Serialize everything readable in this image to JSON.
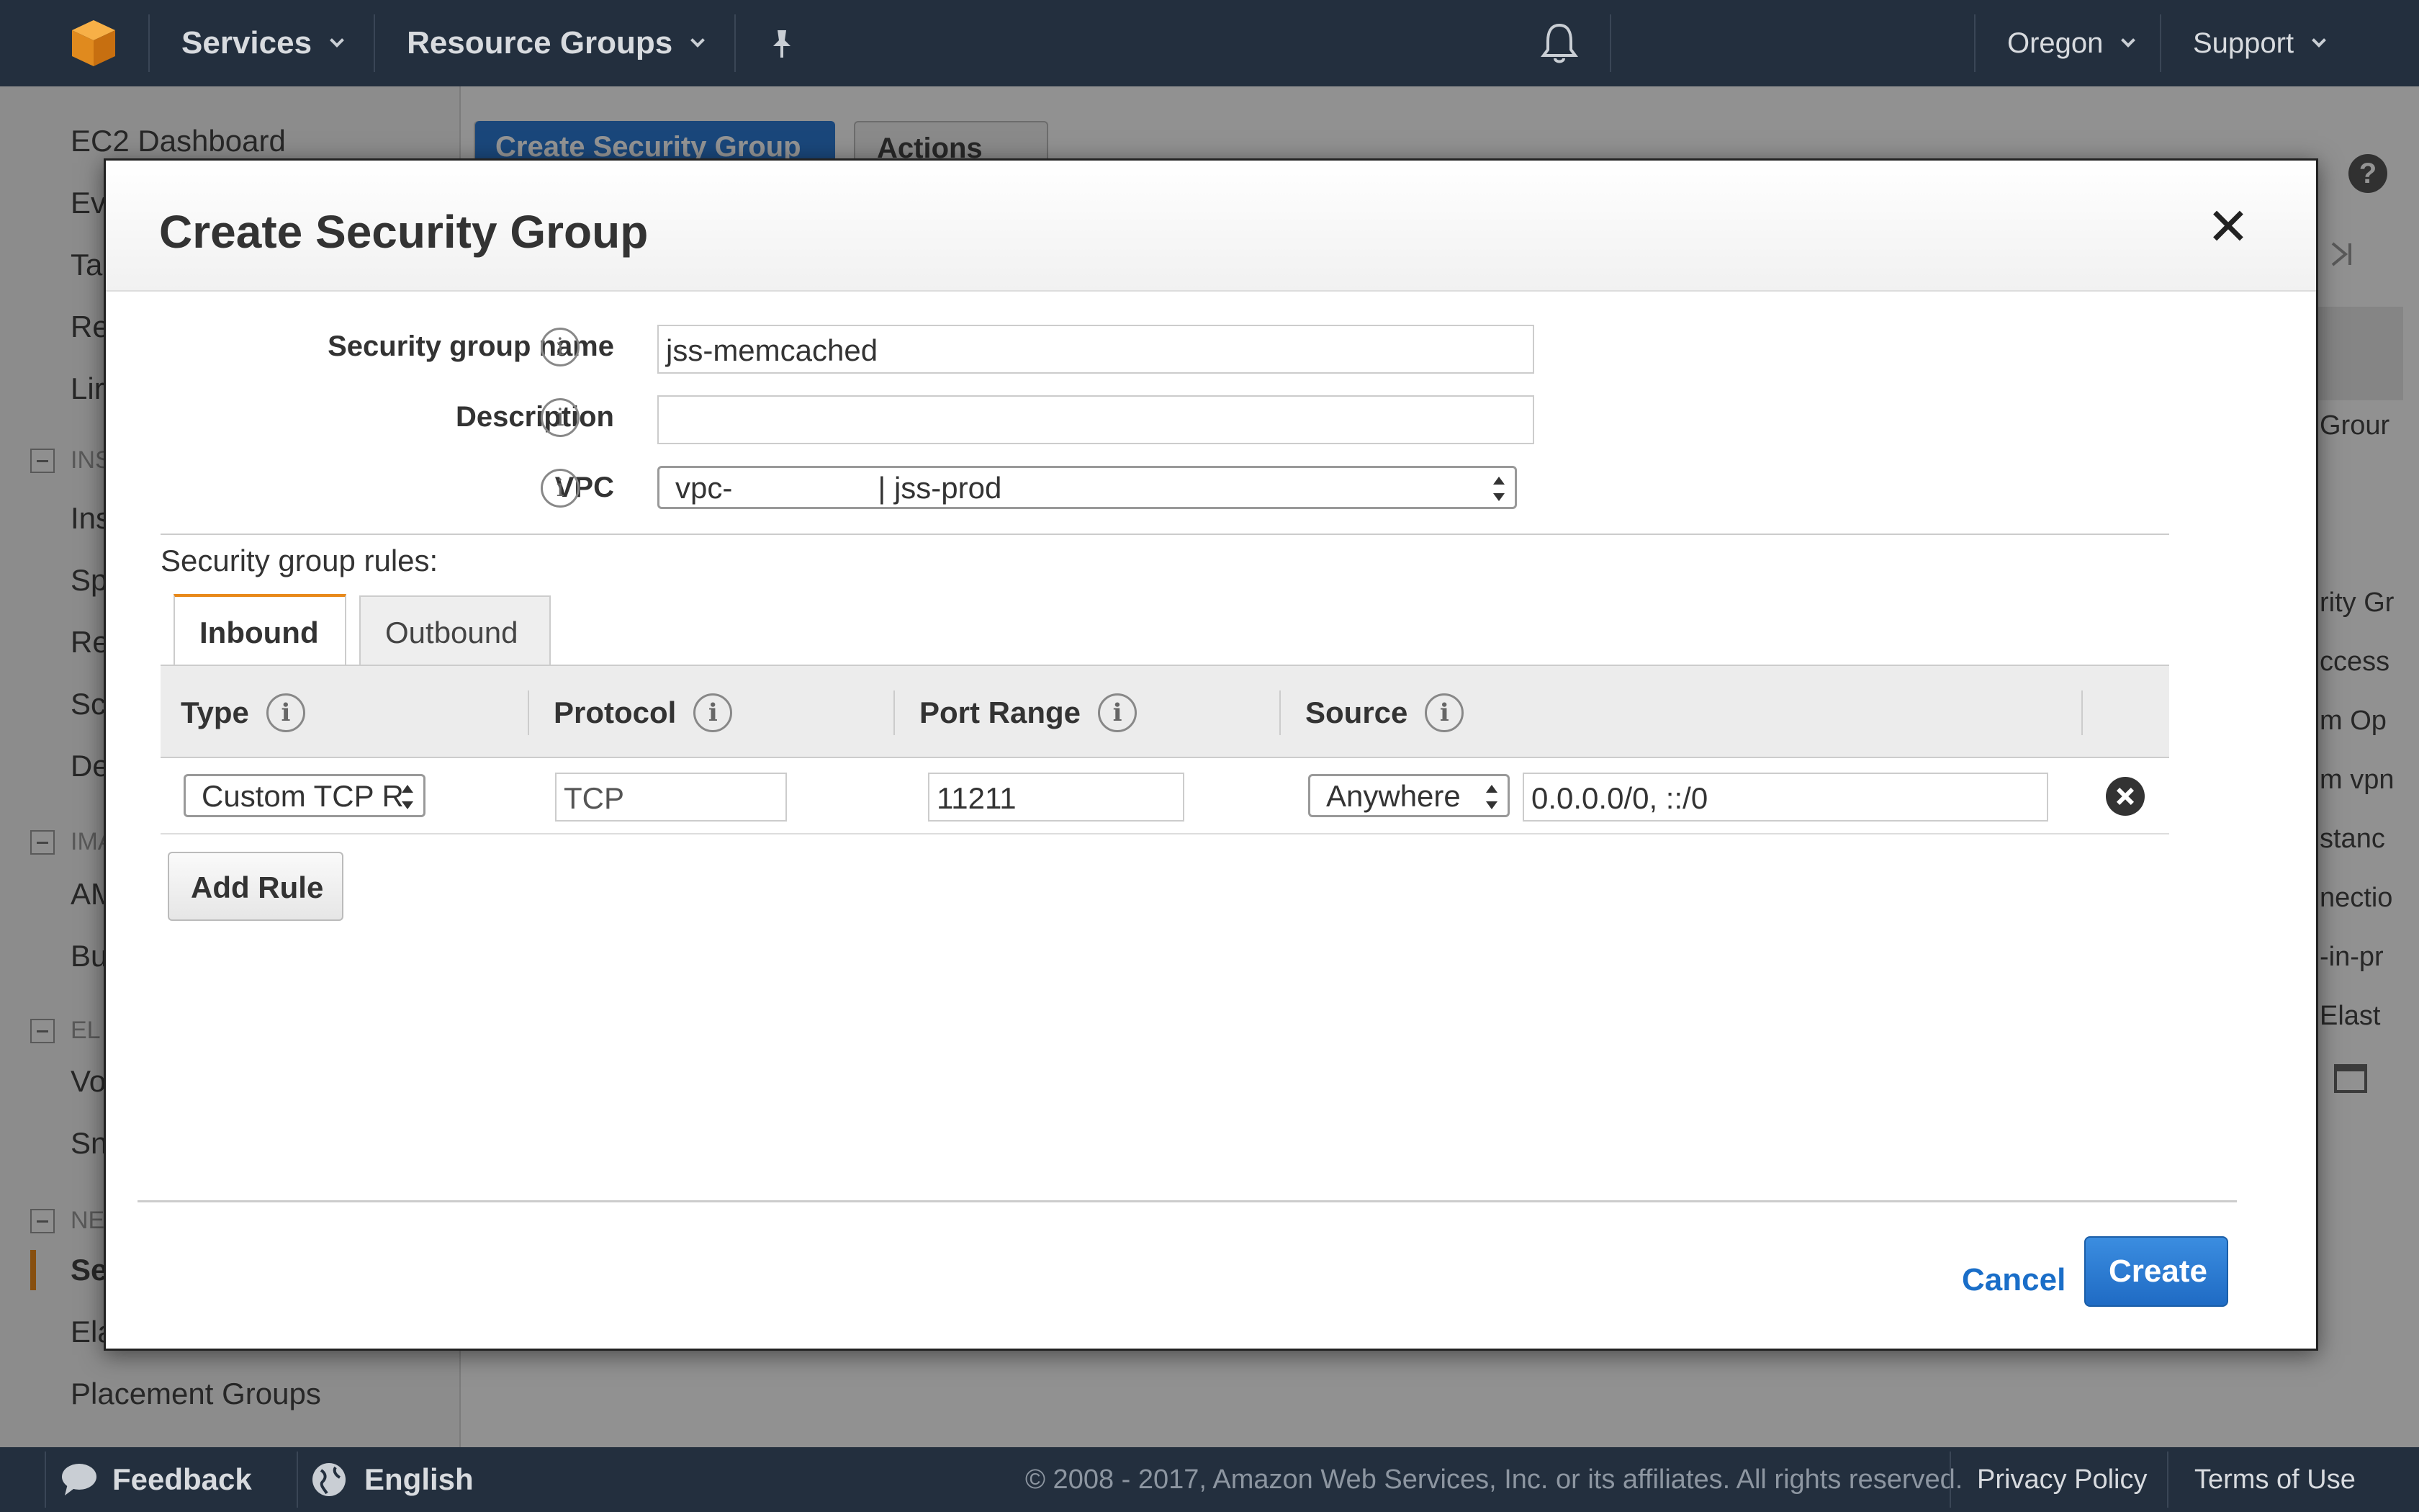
{
  "topnav": {
    "services": "Services",
    "resource_groups": "Resource Groups",
    "region": "Oregon",
    "support": "Support"
  },
  "sidebar": {
    "items": [
      "EC2 Dashboard",
      "Ev",
      "Ta",
      "Re",
      "Lir",
      "Ins",
      "Sp",
      "Re",
      "Sc",
      "De",
      "AM",
      "Bu",
      "Vo",
      "Sn",
      "Se",
      "Ela",
      "Placement Groups"
    ],
    "sections": [
      "INS",
      "IMA",
      "EL",
      "NE"
    ]
  },
  "background": {
    "create_button": "Create Security Group",
    "actions_button": "Actions",
    "right_fragments": [
      "Grour",
      "rity Gr",
      "ccess",
      "m Op",
      "m vpn",
      "stanc",
      "nectio",
      "-in-pr",
      "Elast"
    ]
  },
  "modal": {
    "title": "Create Security Group",
    "name_label": "Security group name",
    "name_value": "jss-memcached",
    "description_label": "Description",
    "description_value": "",
    "vpc_label": "VPC",
    "vpc_prefix": "vpc-",
    "vpc_name": "| jss-prod",
    "rules_label": "Security group rules:",
    "tabs": [
      "Inbound",
      "Outbound"
    ],
    "columns": [
      "Type",
      "Protocol",
      "Port Range",
      "Source"
    ],
    "rule": {
      "type": "Custom TCP R",
      "protocol": "TCP",
      "port_range": "11211",
      "source_mode": "Anywhere",
      "source_value": "0.0.0.0/0, ::/0"
    },
    "add_rule": "Add Rule",
    "cancel": "Cancel",
    "create": "Create"
  },
  "footer": {
    "feedback": "Feedback",
    "language": "English",
    "copyright": "© 2008 - 2017, Amazon Web Services, Inc. or its affiliates. All rights reserved.",
    "privacy": "Privacy Policy",
    "terms": "Terms of Use"
  },
  "colors": {
    "nav_bg": "#232f3e",
    "accent_orange": "#e8891a",
    "primary_blue": "#1f6bc4",
    "link_blue": "#1a6ec8"
  },
  "icons": [
    "aws-logo-icon",
    "pin-icon",
    "bell-icon",
    "info-icon",
    "close-icon",
    "remove-rule-icon",
    "help-icon",
    "chat-bubble-icon",
    "globe-icon"
  ]
}
